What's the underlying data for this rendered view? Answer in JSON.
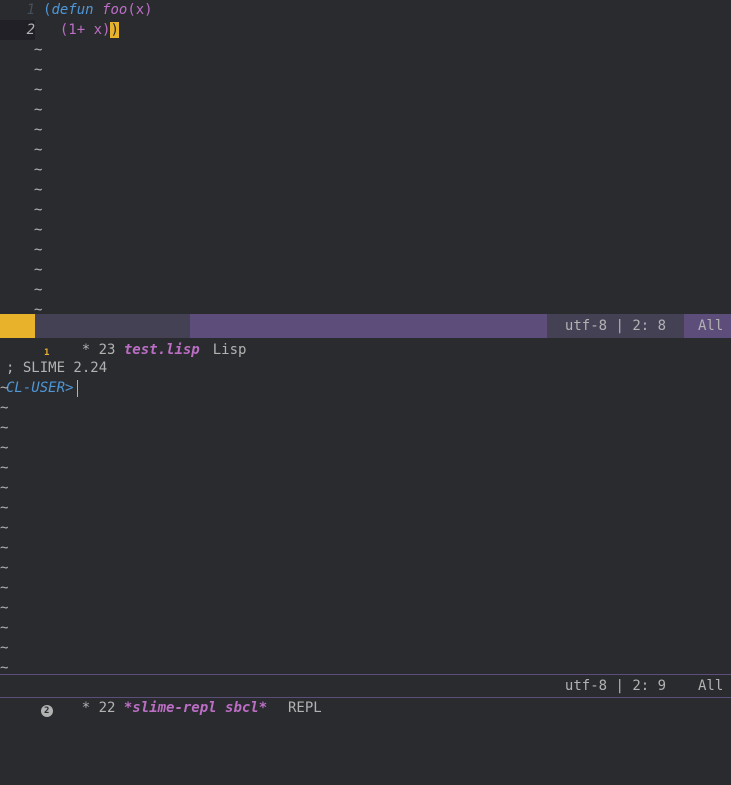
{
  "editor": {
    "lines": [
      {
        "number": "1",
        "open": "(",
        "keyword": "defun",
        "space": " ",
        "name": "foo",
        "args": "(x)"
      },
      {
        "number": "2",
        "indent": "  ",
        "body": "(1+ x)",
        "close": ")"
      }
    ],
    "empty_marker": "~",
    "top_empty_lines": 14
  },
  "modeline_top": {
    "window_number": "1",
    "state": "* 23",
    "buffer_name": "test.lisp",
    "mode": "Lisp",
    "encoding_position": "utf-8 | 2: 8",
    "scroll": "All"
  },
  "repl": {
    "banner": "; SLIME 2.24",
    "prompt": "CL-USER>",
    "empty_marker": "~",
    "empty_lines": 15
  },
  "modeline_bottom": {
    "window_number": "2",
    "state": "* 22",
    "buffer_name": "*slime-repl sbcl*",
    "mode": "REPL",
    "encoding_position": "utf-8 | 2: 9",
    "scroll": "All"
  },
  "colors": {
    "background": "#292b2e",
    "modeline_active": "#5d4d7a",
    "keyword_blue": "#4f97d7",
    "function_purple": "#bc6ec5",
    "paren_match": "#e8b32a"
  }
}
